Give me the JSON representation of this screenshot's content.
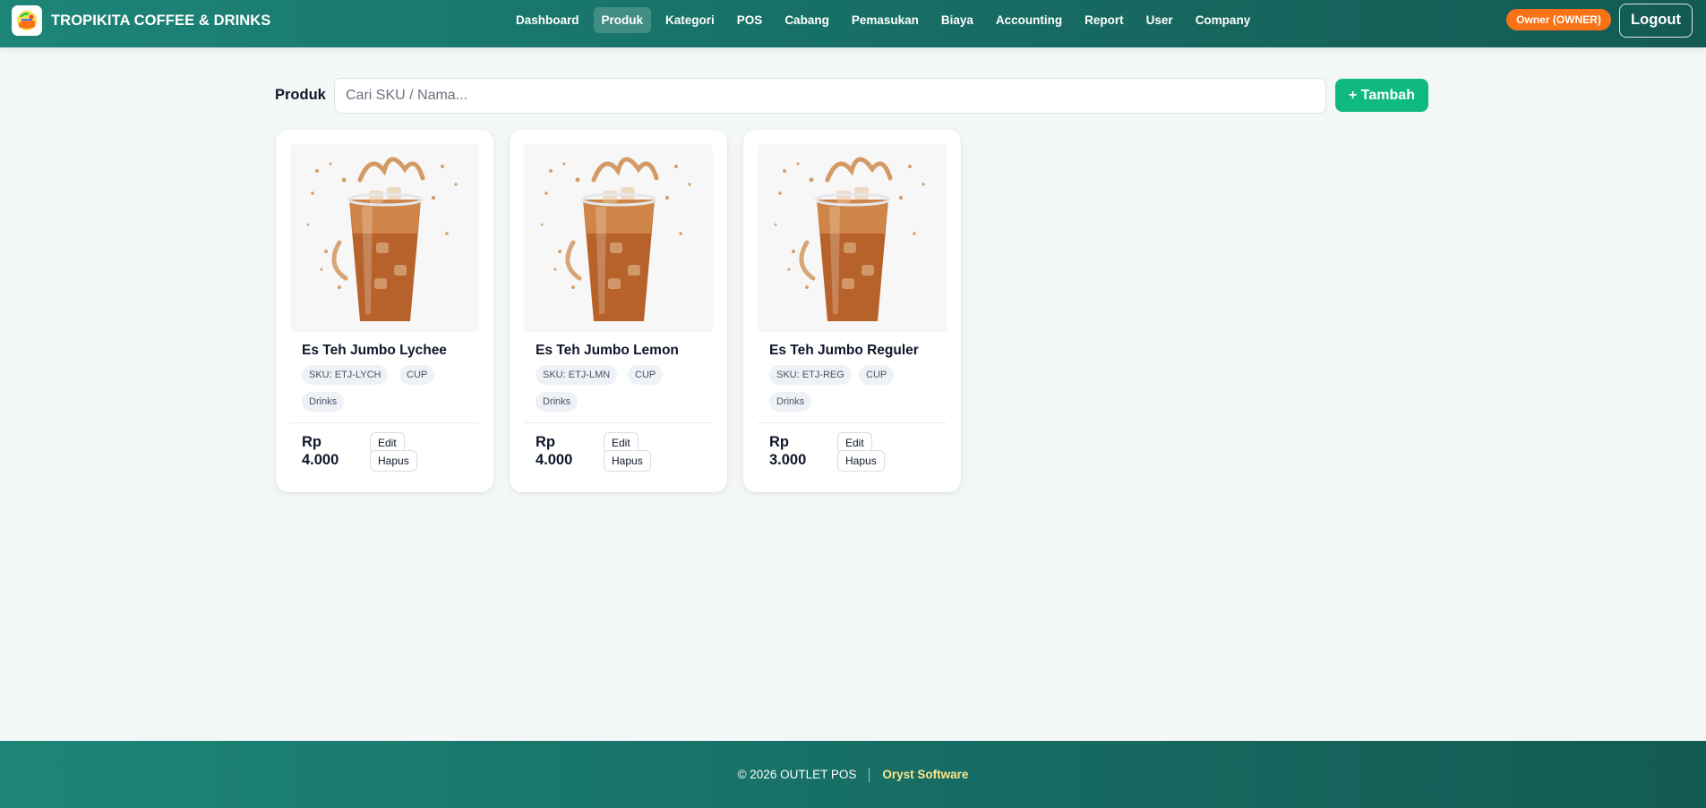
{
  "brand": {
    "name": "TROPIKITA COFFEE & DRINKS",
    "logo_icon": "brand-logo-icon"
  },
  "nav": [
    {
      "label": "Dashboard",
      "active": false
    },
    {
      "label": "Produk",
      "active": true
    },
    {
      "label": "Kategori",
      "active": false
    },
    {
      "label": "POS",
      "active": false
    },
    {
      "label": "Cabang",
      "active": false
    },
    {
      "label": "Pemasukan",
      "active": false
    },
    {
      "label": "Biaya",
      "active": false
    },
    {
      "label": "Accounting",
      "active": false
    },
    {
      "label": "Report",
      "active": false
    },
    {
      "label": "User",
      "active": false
    },
    {
      "label": "Company",
      "active": false
    }
  ],
  "user": {
    "role_badge": "Owner (OWNER)",
    "logout_label": "Logout"
  },
  "page": {
    "title": "Produk",
    "search_placeholder": "Cari SKU / Nama...",
    "search_value": "",
    "add_label": "+ Tambah"
  },
  "products": [
    {
      "name": "Es Teh Jumbo Lychee",
      "sku": "SKU: ETJ-LYCH",
      "unit": "CUP",
      "category": "Drinks",
      "price_currency": "Rp",
      "price_value": "4.000",
      "edit_label": "Edit",
      "delete_label": "Hapus",
      "image_icon": "iced-tea-image"
    },
    {
      "name": "Es Teh Jumbo Lemon",
      "sku": "SKU: ETJ-LMN",
      "unit": "CUP",
      "category": "Drinks",
      "price_currency": "Rp",
      "price_value": "4.000",
      "edit_label": "Edit",
      "delete_label": "Hapus",
      "image_icon": "iced-tea-image"
    },
    {
      "name": "Es Teh Jumbo Reguler",
      "sku": "SKU: ETJ-REG",
      "unit": "CUP",
      "category": "Drinks",
      "price_currency": "Rp",
      "price_value": "3.000",
      "edit_label": "Edit",
      "delete_label": "Hapus",
      "image_icon": "iced-tea-image"
    }
  ],
  "footer": {
    "copyright": "© 2026 OUTLET POS",
    "link": "Oryst Software"
  },
  "colors": {
    "header_start": "#1d8577",
    "header_end": "#145a54",
    "accent_green": "#10b981",
    "badge_orange": "#f97316",
    "footer_link": "#fde68a"
  }
}
